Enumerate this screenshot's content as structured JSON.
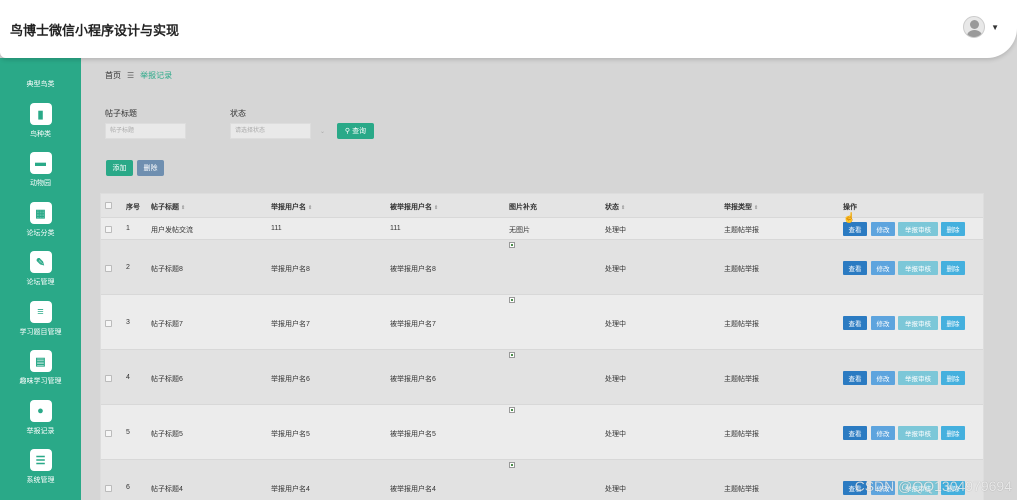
{
  "header": {
    "title": "鸟博士微信小程序设计与实现",
    "user_menu_caret": "▼"
  },
  "sidebar": {
    "top_label": "典型鸟类",
    "items": [
      {
        "label": "鸟种类",
        "icon": "bookmark-icon"
      },
      {
        "label": "动物园",
        "icon": "message-icon"
      },
      {
        "label": "论坛分类",
        "icon": "grid-icon"
      },
      {
        "label": "论坛管理",
        "icon": "edit-icon"
      },
      {
        "label": "学习题目管理",
        "icon": "list-icon"
      },
      {
        "label": "趣味学习管理",
        "icon": "document-icon"
      },
      {
        "label": "举报记录",
        "icon": "user-icon"
      },
      {
        "label": "系统管理",
        "icon": "menu-icon"
      }
    ]
  },
  "breadcrumb": {
    "home": "首页",
    "separator": "☰",
    "current": "举报记录"
  },
  "filters": {
    "post_title_label": "帖子标题",
    "post_title_placeholder": "帖子标题",
    "status_label": "状态",
    "status_placeholder": "请选择状态",
    "search_button": "查询"
  },
  "toolbar": {
    "add_label": "添加",
    "delete_label": "删除"
  },
  "table": {
    "headers": {
      "index": "序号",
      "post_title": "帖子标题",
      "reporter": "举报用户名",
      "reported": "被举报用户名",
      "image": "图片补充",
      "status": "状态",
      "report_type": "举报类型",
      "actions": "操作"
    },
    "sort_glyph": "⇕",
    "actions": {
      "view": "查看",
      "edit": "修改",
      "audit": "举报审核",
      "delete": "删除"
    },
    "rows": [
      {
        "index": "1",
        "post_title": "用户发帖交流",
        "reporter": "111",
        "reported": "111",
        "image": "无图片",
        "status": "处理中",
        "report_type": "主题帖举报"
      },
      {
        "index": "2",
        "post_title": "帖子标题8",
        "reporter": "举报用户名8",
        "reported": "被举报用户名8",
        "image": "",
        "status": "处理中",
        "report_type": "主题帖举报"
      },
      {
        "index": "3",
        "post_title": "帖子标题7",
        "reporter": "举报用户名7",
        "reported": "被举报用户名7",
        "image": "",
        "status": "处理中",
        "report_type": "主题帖举报"
      },
      {
        "index": "4",
        "post_title": "帖子标题6",
        "reporter": "举报用户名6",
        "reported": "被举报用户名6",
        "image": "",
        "status": "处理中",
        "report_type": "主题帖举报"
      },
      {
        "index": "5",
        "post_title": "帖子标题5",
        "reporter": "举报用户名5",
        "reported": "被举报用户名5",
        "image": "",
        "status": "处理中",
        "report_type": "主题帖举报"
      },
      {
        "index": "6",
        "post_title": "帖子标题4",
        "reporter": "举报用户名4",
        "reported": "被举报用户名4",
        "image": "",
        "status": "处理中",
        "report_type": "主题帖举报"
      }
    ]
  },
  "watermark": "CSDN @QQ1304979694",
  "colors": {
    "accent": "#2aa988",
    "view": "#2b7bc2",
    "edit": "#5da4de",
    "audit": "#7cc7d8",
    "delete": "#44b0de"
  }
}
